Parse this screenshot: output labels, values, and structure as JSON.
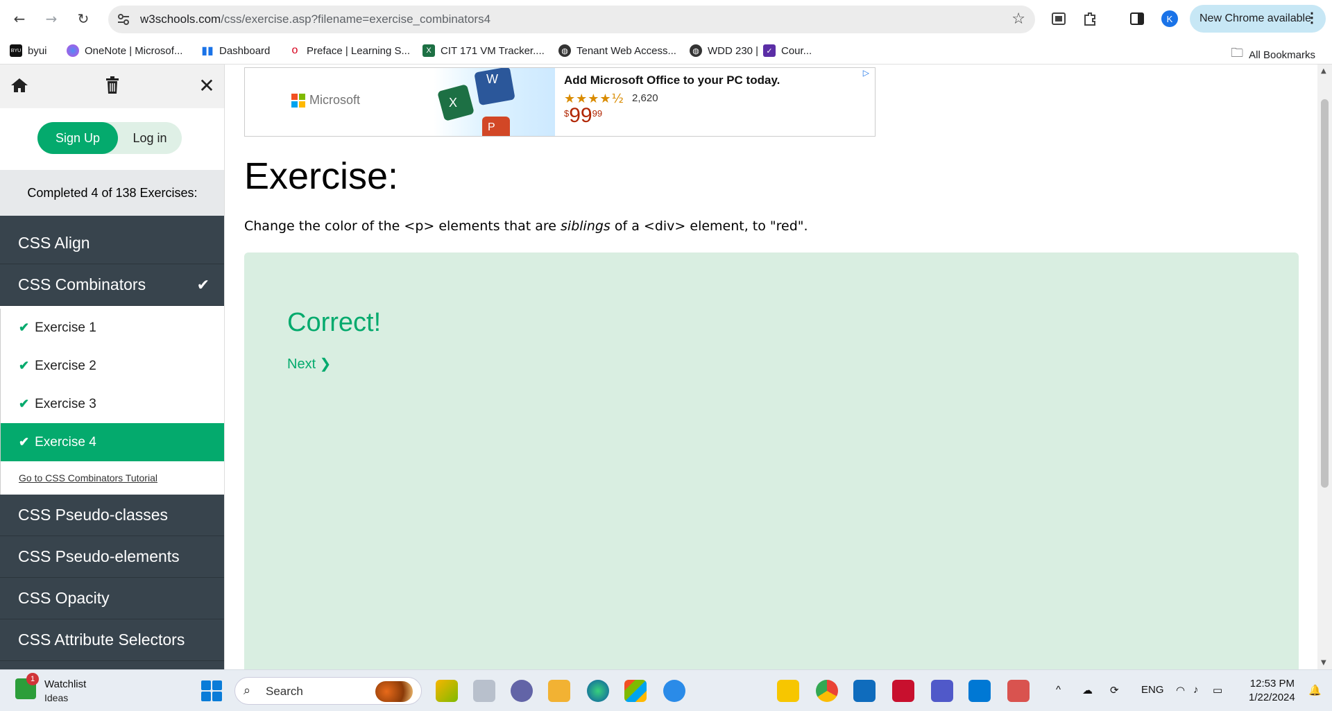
{
  "browser": {
    "url_host": "w3schools.com",
    "url_path": "/css/exercise.asp?filename=exercise_combinators4",
    "profile_initial": "K",
    "update_label": "New Chrome available"
  },
  "bookmarks": {
    "items": [
      {
        "label": "byui"
      },
      {
        "label": "OneNote | Microsof..."
      },
      {
        "label": "Dashboard"
      },
      {
        "label": "Preface | Learning S..."
      },
      {
        "label": "CIT 171 VM Tracker...."
      },
      {
        "label": "Tenant Web Access..."
      },
      {
        "label": "WDD 230 |"
      },
      {
        "label": "Cour..."
      }
    ],
    "all_label": "All Bookmarks"
  },
  "sidebar": {
    "signup": "Sign Up",
    "login": "Log in",
    "completed": "Completed 4 of 138 Exercises:",
    "sections_top": [
      {
        "label": "CSS Align"
      },
      {
        "label": "CSS Combinators"
      }
    ],
    "exercises": [
      {
        "label": "Exercise 1"
      },
      {
        "label": "Exercise 2"
      },
      {
        "label": "Exercise 3"
      },
      {
        "label": "Exercise 4"
      }
    ],
    "tutorial_link": "Go to CSS Combinators Tutorial",
    "sections_bottom": [
      {
        "label": "CSS Pseudo-classes"
      },
      {
        "label": "CSS Pseudo-elements"
      },
      {
        "label": "CSS Opacity"
      },
      {
        "label": "CSS Attribute Selectors"
      }
    ]
  },
  "ad": {
    "brand": "Microsoft",
    "title": "Add Microsoft Office to your PC today.",
    "stars": "★★★★½",
    "rating_count": "2,620",
    "price_currency": "$",
    "price_main": "99",
    "price_cents": "99"
  },
  "main": {
    "heading": "Exercise:",
    "instruction_1": "Change the color of the <p> elements that are ",
    "instruction_em": "siblings",
    "instruction_2": " of a <div> element, to \"red\".",
    "result": "Correct!",
    "next": "Next ❯"
  },
  "taskbar": {
    "widget_badge": "1",
    "widget_title": "Watchlist",
    "widget_sub": "Ideas",
    "search": "Search",
    "language": "ENG",
    "time": "12:53 PM",
    "date": "1/22/2024"
  },
  "colors": {
    "accent": "#04aa6d",
    "sidebar_dark": "#38444d",
    "result_bg": "#d9eee1"
  }
}
